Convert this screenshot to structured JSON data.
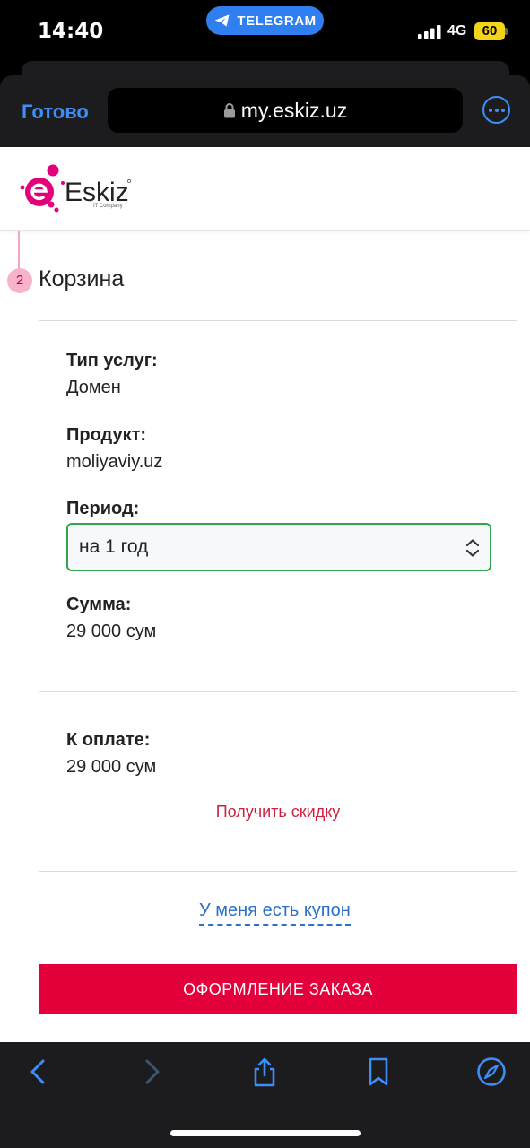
{
  "status_bar": {
    "time": "14:40",
    "app_pill": "TELEGRAM",
    "network": "4G",
    "battery": "60"
  },
  "browser": {
    "done_label": "Готово",
    "url": "my.eskiz.uz"
  },
  "site": {
    "logo_name": "Eskiz",
    "logo_sub": "IT Company"
  },
  "step": {
    "number": "2",
    "title": "Корзина"
  },
  "order": {
    "service_type_label": "Тип услуг:",
    "service_type_value": "Домен",
    "product_label": "Продукт:",
    "product_value": "moliyaviy.uz",
    "period_label": "Период:",
    "period_selected": "на 1 год",
    "sum_label": "Сумма:",
    "sum_value": "29 000 сум"
  },
  "payment": {
    "to_pay_label": "К оплате:",
    "to_pay_value": "29 000 сум",
    "discount_link": "Получить скидку"
  },
  "coupon_link": "У меня есть купон",
  "checkout_button": "ОФОРМЛЕНИЕ ЗАКАЗА",
  "colors": {
    "brand": "#e4003a",
    "link_blue": "#2d6fc9",
    "ios_blue": "#3e8ef7",
    "select_border": "#2fa74a"
  },
  "icons": [
    "telegram-icon",
    "signal-icon",
    "lock-icon",
    "more-icon",
    "chevron-updown-icon",
    "back-icon",
    "forward-icon",
    "share-icon",
    "bookmarks-icon",
    "compass-icon"
  ]
}
